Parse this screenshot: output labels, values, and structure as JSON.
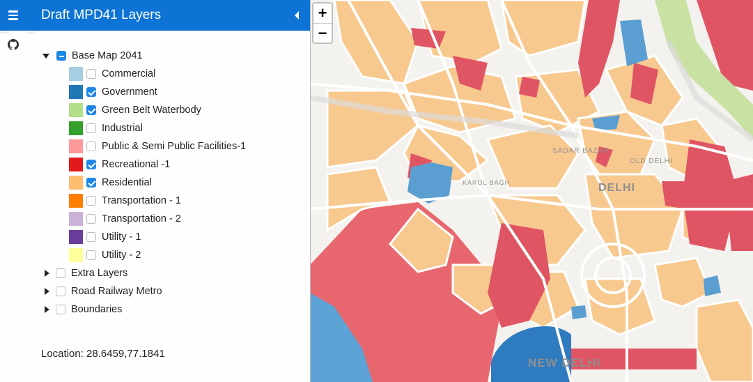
{
  "sidebar": {
    "title": "Draft MPD41 Layers",
    "location_label": "Location: 28.6459,77.1841"
  },
  "icons": {
    "menu": "hamburger-icon",
    "collapse": "triangle-left-icon",
    "github": "github-icon",
    "crosshair": "crosshair-icon"
  },
  "layers": {
    "base_map": {
      "label": "Base Map 2041",
      "expanded": true,
      "state": "indeterminate",
      "items": [
        {
          "label": "Commercial",
          "color": "#a6cee3",
          "checked": false
        },
        {
          "label": "Government",
          "color": "#1f78b4",
          "checked": true
        },
        {
          "label": "Green Belt Waterbody",
          "color": "#b2df8a",
          "checked": true
        },
        {
          "label": "Industrial",
          "color": "#33a02c",
          "checked": false
        },
        {
          "label": "Public & Semi Public Facilities-1",
          "color": "#fb9a99",
          "checked": false
        },
        {
          "label": "Recreational -1",
          "color": "#e31a1c",
          "checked": true
        },
        {
          "label": "Residential",
          "color": "#fdbf6f",
          "checked": true
        },
        {
          "label": "Transportation - 1",
          "color": "#ff7f00",
          "checked": false
        },
        {
          "label": "Transportation - 2",
          "color": "#cab2d6",
          "checked": false
        },
        {
          "label": "Utility - 1",
          "color": "#6a3d9a",
          "checked": false
        },
        {
          "label": "Utility - 2",
          "color": "#ffff99",
          "checked": false
        }
      ]
    },
    "groups": [
      {
        "label": "Extra Layers",
        "expanded": false,
        "checked": false
      },
      {
        "label": "Road Railway Metro",
        "expanded": false,
        "checked": false
      },
      {
        "label": "Boundaries",
        "expanded": false,
        "checked": false
      }
    ]
  },
  "map": {
    "zoom_in": "+",
    "zoom_out": "−",
    "labels": {
      "sadar_bazar": "SADAR BAZAR",
      "karol_bagh": "KAROL BAGH",
      "old_delhi": "OLD DELHI",
      "delhi": "DELHI",
      "new_delhi": "NEW DELHI"
    }
  }
}
